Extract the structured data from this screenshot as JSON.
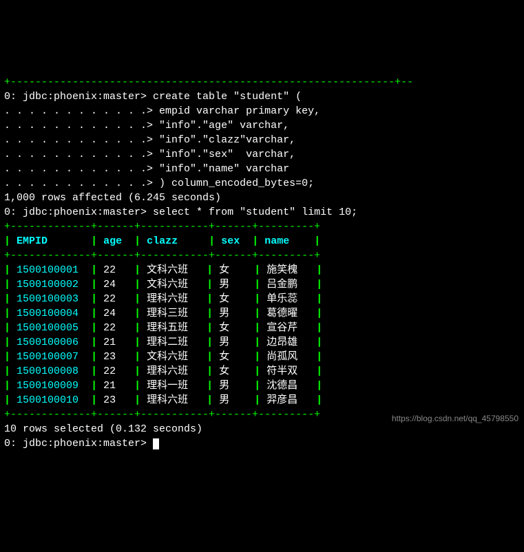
{
  "top_dash": "+--------------------------------------------------------------+--",
  "prompt_prefix": "0: jdbc:phoenix:master>",
  "cont_prefix": ". . . . . . . . . . . .>",
  "sql": {
    "create_l1": " create table \"student\" (",
    "create_l2": " empid varchar primary key,",
    "create_l3": " \"info\".\"age\" varchar,",
    "create_l4": " \"info\".\"clazz\"varchar,",
    "create_l5": " \"info\".\"sex\"  varchar,",
    "create_l6": " \"info\".\"name\" varchar",
    "create_l7": " ) column_encoded_bytes=0;",
    "affected": "1,000 rows affected (6.245 seconds)",
    "select": " select * from \"student\" limit 10;",
    "selected": "10 rows selected (0.132 seconds)"
  },
  "table": {
    "dash": "+-------------+------+-----------+------+---------+",
    "headers": [
      "EMPID",
      "age",
      "clazz",
      "sex",
      "name"
    ],
    "rows": [
      {
        "empid": "1500100001",
        "age": "22",
        "clazz": "文科六班",
        "sex": "女",
        "name": "施笑槐"
      },
      {
        "empid": "1500100002",
        "age": "24",
        "clazz": "文科六班",
        "sex": "男",
        "name": "吕金鹏"
      },
      {
        "empid": "1500100003",
        "age": "22",
        "clazz": "理科六班",
        "sex": "女",
        "name": "单乐蕊"
      },
      {
        "empid": "1500100004",
        "age": "24",
        "clazz": "理科三班",
        "sex": "男",
        "name": "葛德曜"
      },
      {
        "empid": "1500100005",
        "age": "22",
        "clazz": "理科五班",
        "sex": "女",
        "name": "宣谷芹"
      },
      {
        "empid": "1500100006",
        "age": "21",
        "clazz": "理科二班",
        "sex": "男",
        "name": "边昂雄"
      },
      {
        "empid": "1500100007",
        "age": "23",
        "clazz": "文科六班",
        "sex": "女",
        "name": "尚孤风"
      },
      {
        "empid": "1500100008",
        "age": "22",
        "clazz": "理科六班",
        "sex": "女",
        "name": "符半双"
      },
      {
        "empid": "1500100009",
        "age": "21",
        "clazz": "理科一班",
        "sex": "男",
        "name": "沈德昌"
      },
      {
        "empid": "1500100010",
        "age": "23",
        "clazz": "理科六班",
        "sex": "男",
        "name": "羿彦昌"
      }
    ]
  },
  "watermark": "https://blog.csdn.net/qq_45798550"
}
